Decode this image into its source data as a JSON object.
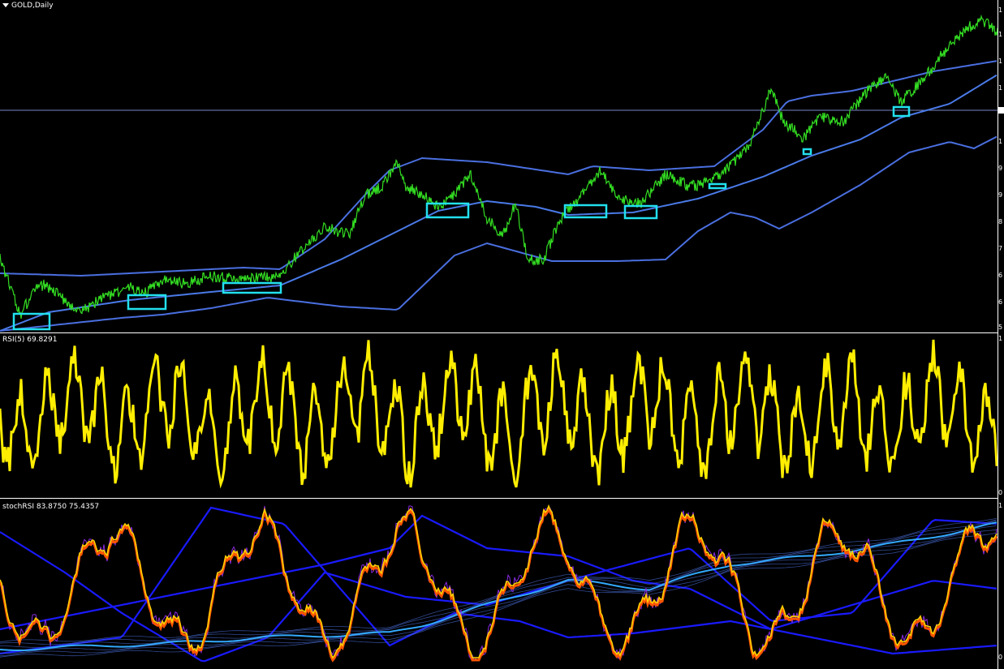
{
  "header": {
    "symbol_label": "GOLD,Daily"
  },
  "rsi": {
    "label": "RSI(5) 69.8291"
  },
  "stoch": {
    "label": "stochRSI 83.8750 75.4357"
  },
  "axis": {
    "main_ticks": [
      "1",
      "1",
      "1",
      "1",
      "1",
      "1",
      "1",
      "1",
      "9",
      "9",
      "8",
      "7",
      "6",
      "6",
      "5",
      "5"
    ],
    "rsi_ticks": [
      "1",
      "0"
    ],
    "stoch_ticks": [
      "1",
      "0"
    ]
  },
  "colors": {
    "price": "#33dd22",
    "bands": "#4a6fe0",
    "mid": "#5a8cff",
    "rsi": "#ffee00",
    "stoch_fast": "#ffd000",
    "stoch_slow": "#ff5500",
    "stoch_bands": "#1a1aff",
    "highlight_box": "#22e0ee"
  },
  "highlight_boxes_icon": "rect-highlight"
}
